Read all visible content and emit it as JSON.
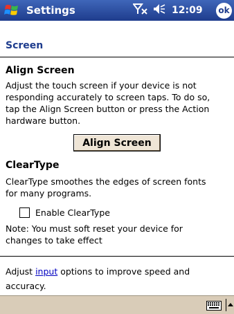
{
  "titlebar": {
    "title": "Settings",
    "time": "12:09",
    "ok_label": "ok"
  },
  "page": {
    "header": "Screen"
  },
  "align_section": {
    "title": "Align Screen",
    "lines": [
      "Adjust the touch screen if your device is not",
      "responding accurately to screen taps. To do so,",
      "tap the Align Screen button or press the Action",
      "hardware button."
    ],
    "button_label": "Align Screen"
  },
  "cleartype_section": {
    "title": "ClearType",
    "lines": [
      "ClearType smoothes the edges of screen fonts",
      "for many programs."
    ],
    "checkbox_label": "Enable ClearType",
    "checkbox_checked": false,
    "note_lines": [
      "Note: You must soft reset your device for",
      "changes to take effect"
    ]
  },
  "input_hint": {
    "prefix": "Adjust ",
    "link": "input",
    "suffix": " options to improve speed and",
    "line2": "accuracy."
  },
  "icons": {
    "start": "windows-flag-icon",
    "signal": "signal-off-icon",
    "volume": "volume-icon",
    "keyboard": "keyboard-icon",
    "sip_arrow": "up-arrow-icon"
  }
}
